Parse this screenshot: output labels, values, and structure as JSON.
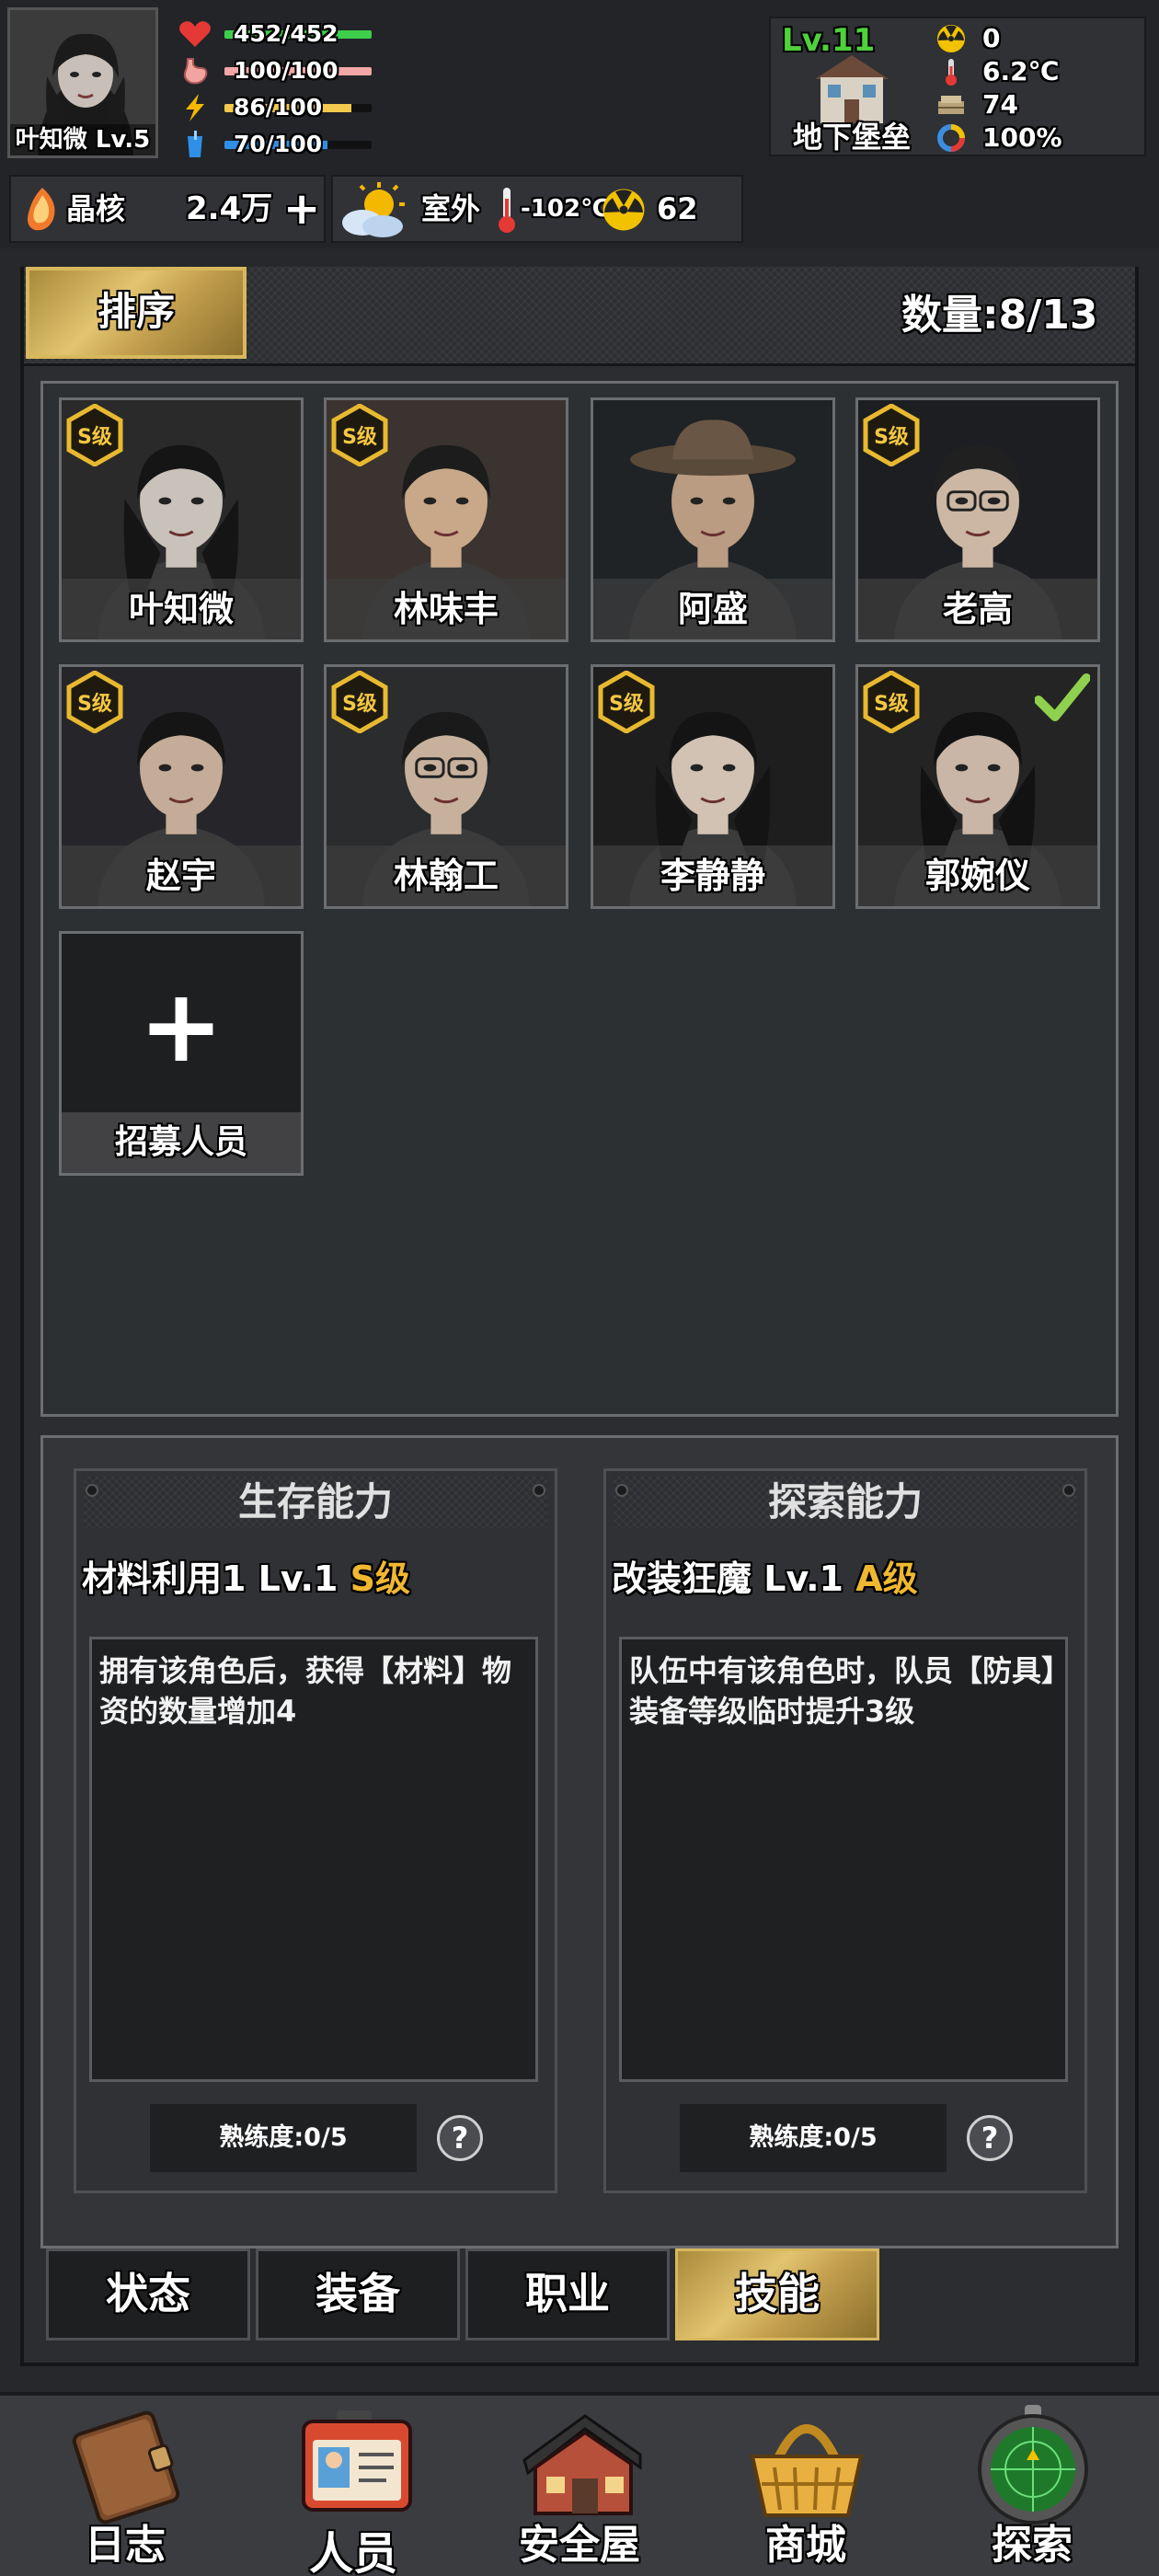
{
  "hud": {
    "player_name": "叶知微 Lv.5",
    "stats": [
      {
        "icon": "heart-icon",
        "text": "452/452",
        "fill": 1.0,
        "color": "#3ecf4a"
      },
      {
        "icon": "stomach-icon",
        "text": "100/100",
        "fill": 1.0,
        "color": "#f2a6a6"
      },
      {
        "icon": "lightning-icon",
        "text": "86/100",
        "fill": 0.86,
        "color": "#f2c94c"
      },
      {
        "icon": "water-cup-icon",
        "text": "70/100",
        "fill": 0.7,
        "color": "#2f8fe6"
      }
    ],
    "shelter": {
      "level": "Lv.11",
      "name": "地下堡垒",
      "radiation": "0",
      "temperature": "6.2℃",
      "supplies": "74",
      "efficiency": "100%"
    },
    "crystal": {
      "label": "晶核",
      "value": "2.4万",
      "add": "+"
    },
    "weather": {
      "location": "室外",
      "temperature": "-102℃",
      "radiation": "62"
    }
  },
  "roster": {
    "sort_label": "排序",
    "count_label": "数量:8/13",
    "members": [
      {
        "name": "叶知微",
        "grade": "S级",
        "selected": false
      },
      {
        "name": "林味丰",
        "grade": "S级",
        "selected": false
      },
      {
        "name": "阿盛",
        "grade": "",
        "selected": false
      },
      {
        "name": "老高",
        "grade": "S级",
        "selected": false
      },
      {
        "name": "赵宇",
        "grade": "S级",
        "selected": false
      },
      {
        "name": "林翰工",
        "grade": "S级",
        "selected": false
      },
      {
        "name": "李静静",
        "grade": "S级",
        "selected": false
      },
      {
        "name": "郭婉仪",
        "grade": "S级",
        "selected": true
      }
    ],
    "recruit_label": "招募人员",
    "recruit_plus": "+"
  },
  "skills": {
    "survival": {
      "title": "生存能力",
      "name": "材料利用1 Lv.1",
      "grade": "S级",
      "description": "拥有该角色后，获得【材料】物资的数量增加4",
      "proficiency": "熟练度:0/5"
    },
    "exploration": {
      "title": "探索能力",
      "name": "改装狂魔 Lv.1",
      "grade": "A级",
      "description": "队伍中有该角色时，队员【防具】装备等级临时提升3级",
      "proficiency": "熟练度:0/5"
    },
    "help_glyph": "?"
  },
  "tabs": [
    {
      "label": "状态",
      "active": false
    },
    {
      "label": "装备",
      "active": false
    },
    {
      "label": "职业",
      "active": false
    },
    {
      "label": "技能",
      "active": true
    }
  ],
  "nav": [
    {
      "label": "日志",
      "icon": "journal-book-icon"
    },
    {
      "label": "人员",
      "icon": "id-card-icon"
    },
    {
      "label": "安全屋",
      "icon": "safehouse-icon"
    },
    {
      "label": "商城",
      "icon": "shopping-basket-icon"
    },
    {
      "label": "探索",
      "icon": "radar-icon"
    }
  ],
  "colors": {
    "gold_accent": "#d8b85c",
    "grade_color": "#f0b830",
    "level_green": "#4fd13b"
  }
}
